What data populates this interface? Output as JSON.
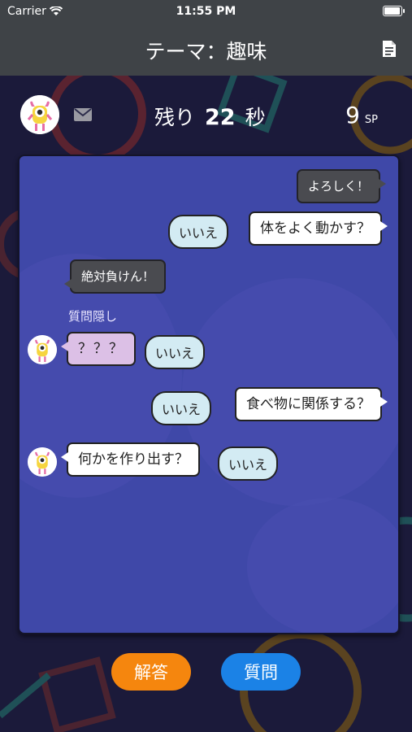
{
  "status_bar": {
    "carrier": "Carrier",
    "time": "11:55 PM"
  },
  "nav": {
    "title": "テーマ：趣味"
  },
  "info": {
    "remaining_label": "残り",
    "seconds": "22",
    "seconds_unit": "秒",
    "sp_value": "9",
    "sp_unit": "SP"
  },
  "chat": {
    "messages": [
      {
        "side": "right",
        "style": "dark",
        "text": "よろしく！"
      },
      {
        "side": "right",
        "style": "white",
        "text": "体をよく動かす？",
        "answer": "いいえ"
      },
      {
        "side": "left",
        "style": "dark",
        "text": "絶対負けん！"
      },
      {
        "side": "left",
        "label": "質問隠し",
        "style": "pink",
        "text": "？？？",
        "answer": "いいえ"
      },
      {
        "side": "right",
        "style": "white",
        "text": "食べ物に関係する？",
        "answer": "いいえ"
      },
      {
        "side": "left",
        "style": "white",
        "text": "何かを作り出す？",
        "answer": "いいえ"
      }
    ]
  },
  "buttons": {
    "answer": "解答",
    "question": "質問"
  },
  "colors": {
    "answer_button": "#f5860e",
    "question_button": "#1b82e6",
    "chat_panel": "#3f48a8",
    "nav_bar": "#3f4347"
  },
  "icons": {
    "wifi": "wifi-icon",
    "battery": "battery-icon",
    "document": "document-icon",
    "mail": "mail-icon",
    "avatar": "monster-avatar"
  }
}
